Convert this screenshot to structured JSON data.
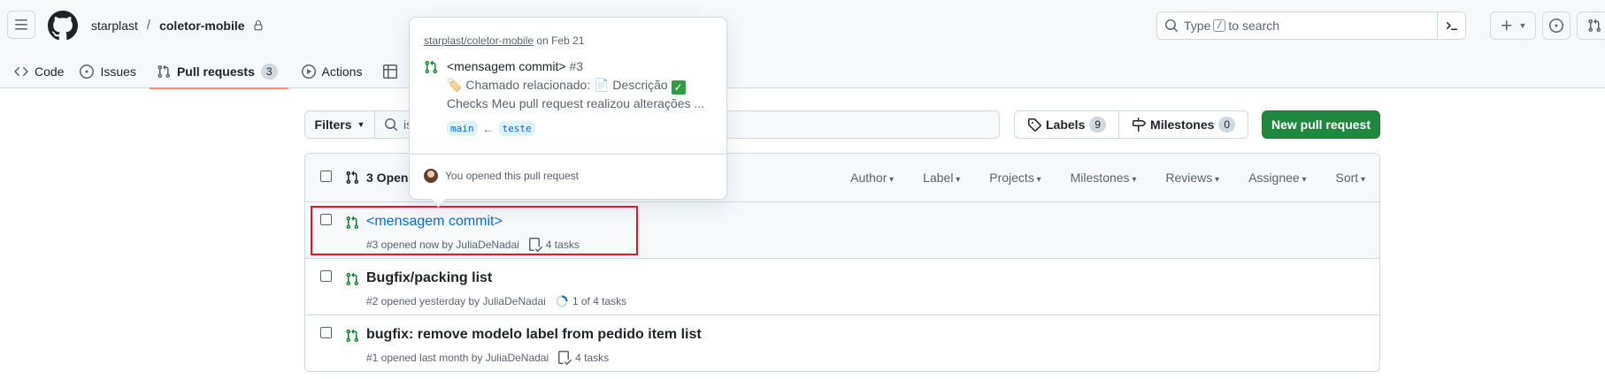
{
  "header": {
    "owner": "starplast",
    "separator": "/",
    "repo": "coletor-mobile",
    "search": {
      "prefix": "Type",
      "key": "/",
      "suffix": "to search"
    }
  },
  "tabs": [
    {
      "label": "Code"
    },
    {
      "label": "Issues"
    },
    {
      "label": "Pull requests",
      "count": "3"
    },
    {
      "label": "Actions"
    }
  ],
  "filters": {
    "filters_label": "Filters",
    "query_visible": "is",
    "labels": {
      "label": "Labels",
      "count": "9"
    },
    "milestones": {
      "label": "Milestones",
      "count": "0"
    },
    "new_pr": "New pull request"
  },
  "list": {
    "open_count": "3 Open",
    "menus": [
      "Author",
      "Label",
      "Projects",
      "Milestones",
      "Reviews",
      "Assignee",
      "Sort"
    ],
    "rows": [
      {
        "title": "<mensagem commit>",
        "meta": "#3 opened now by JuliaDeNadai",
        "tasks": "4 tasks"
      },
      {
        "title": "Bugfix/packing list",
        "meta": "#2 opened yesterday by JuliaDeNadai",
        "tasks": "1 of 4 tasks"
      },
      {
        "title": "bugfix: remove modelo label from pedido item list",
        "meta": "#1 opened last month by JuliaDeNadai",
        "tasks": "4 tasks"
      }
    ]
  },
  "hovercard": {
    "repo": "starplast/coletor-mobile",
    "date": "on Feb 21",
    "title": "<mensagem commit>",
    "number": "#3",
    "line1": "Chamado relacionado:",
    "line1b": "Descrição",
    "line2": "Checks Meu pull request realizou alterações ...",
    "base": "main",
    "arrow": "←",
    "head": "teste",
    "footer": "You opened this pull request"
  },
  "colors": {
    "accent": "#0969da",
    "success": "#1f883d",
    "highlight": "#e0152a",
    "tab_underline": "#fd8c73"
  }
}
